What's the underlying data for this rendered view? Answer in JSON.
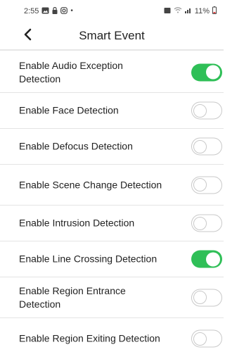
{
  "status_bar": {
    "time": "2:55",
    "left_icons": [
      "gallery-icon",
      "lock-icon",
      "instagram-icon",
      "dot-icon"
    ],
    "battery": "11%"
  },
  "header": {
    "title": "Smart Event"
  },
  "colors": {
    "accent": "#2fbf57"
  },
  "items": [
    {
      "label": "Enable Audio Exception Detection",
      "enabled": true
    },
    {
      "label": "Enable Face Detection",
      "enabled": false
    },
    {
      "label": "Enable Defocus Detection",
      "enabled": false
    },
    {
      "label": "Enable Scene Change Detection",
      "enabled": false
    },
    {
      "label": "Enable Intrusion Detection",
      "enabled": false
    },
    {
      "label": "Enable Line Crossing Detection",
      "enabled": true
    },
    {
      "label": "Enable Region Entrance Detection",
      "enabled": false
    },
    {
      "label": "Enable Region Exiting Detection",
      "enabled": false
    }
  ]
}
